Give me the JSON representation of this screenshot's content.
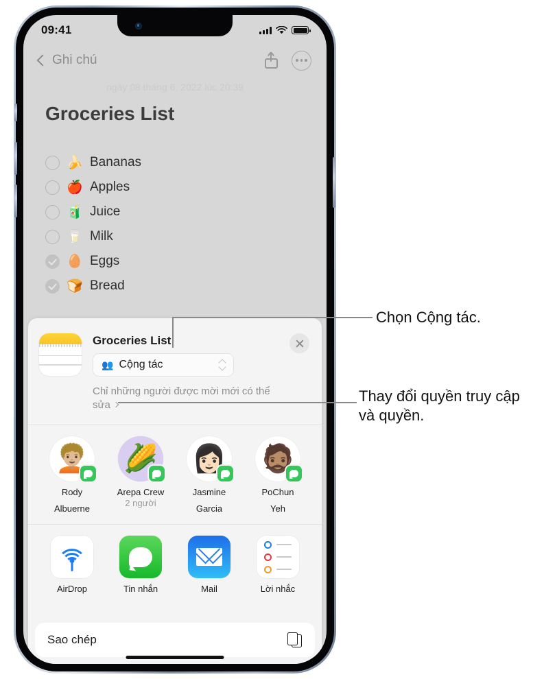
{
  "status_bar": {
    "time": "09:41",
    "signal_icon": "cellular-bars-icon",
    "wifi_icon": "wifi-icon",
    "battery_icon": "battery-full-icon"
  },
  "note_navbar": {
    "back_label": "Ghi chú",
    "share_icon": "share-icon",
    "more_icon": "more-options-icon"
  },
  "note": {
    "date": "ngày 08 tháng 6, 2022 lúc 20:39",
    "title": "Groceries List",
    "items": [
      {
        "emoji": "🍌",
        "label": "Bananas",
        "checked": false
      },
      {
        "emoji": "🍎",
        "label": "Apples",
        "checked": false
      },
      {
        "emoji": "🧃",
        "label": "Juice",
        "checked": false
      },
      {
        "emoji": "🥛",
        "label": "Milk",
        "checked": false
      },
      {
        "emoji": "🥚",
        "label": "Eggs",
        "checked": true
      },
      {
        "emoji": "🍞",
        "label": "Bread",
        "checked": true
      }
    ]
  },
  "share_sheet": {
    "app_icon": "notes-app-icon",
    "title": "Groceries List",
    "collab_option": "Cộng tác",
    "collab_people_icon": "people-icon",
    "collab_chevron_icon": "up-down-chevron-icon",
    "permission_text": "Chỉ những người được mời mới có thể sửa",
    "permission_arrow_icon": "chevron-right-icon",
    "close_icon": "close-icon",
    "contacts": [
      {
        "name_line1": "Rody",
        "name_line2": "Albuerne",
        "sub": "",
        "emoji": "🧑🏼‍🦱",
        "bg": "#ffffff",
        "badge": "messages-badge-icon"
      },
      {
        "name_line1": "Arepa Crew",
        "name_line2": "",
        "sub": "2 người",
        "emoji": "🌽",
        "bg": "#d9cdf2",
        "badge": "messages-badge-icon"
      },
      {
        "name_line1": "Jasmine",
        "name_line2": "Garcia",
        "sub": "",
        "emoji": "👩🏻",
        "bg": "#ffffff",
        "badge": "messages-badge-icon"
      },
      {
        "name_line1": "PoChun",
        "name_line2": "Yeh",
        "sub": "",
        "emoji": "🧔🏽",
        "bg": "#ffffff",
        "badge": "messages-badge-icon"
      }
    ],
    "apps": [
      {
        "label": "AirDrop",
        "icon": "airdrop-icon"
      },
      {
        "label": "Tin nhắn",
        "icon": "messages-icon"
      },
      {
        "label": "Mail",
        "icon": "mail-icon"
      },
      {
        "label": "Lời nhắc",
        "icon": "reminders-icon"
      }
    ],
    "copy_action": {
      "label": "Sao chép",
      "icon": "copy-icon"
    }
  },
  "annotations": {
    "callout_1": "Chọn Cộng tác.",
    "callout_2": "Thay đổi quyền truy cập và quyền."
  },
  "colors": {
    "note_background": "#d7d7d7",
    "sheet_background": "#f4f4f4",
    "accent_green": "#35c759",
    "accent_blue": "#1d7df2",
    "notes_yellow": "#fdd535"
  }
}
